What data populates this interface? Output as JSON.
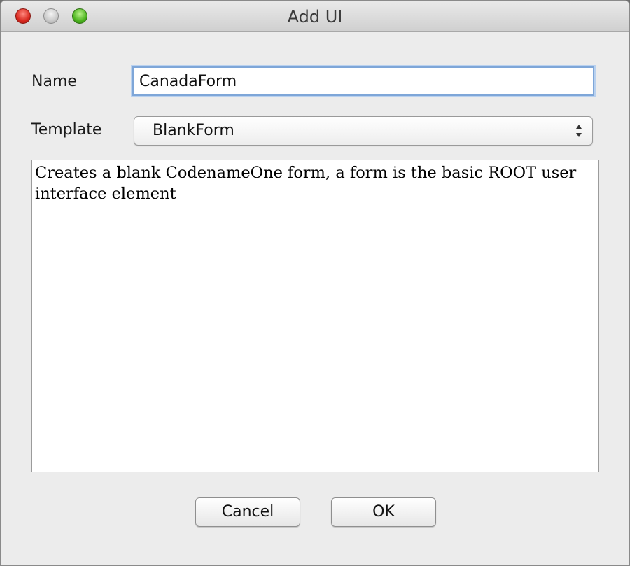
{
  "window": {
    "title": "Add UI"
  },
  "form": {
    "name_label": "Name",
    "name_value": "CanadaForm",
    "template_label": "Template",
    "template_value": "BlankForm",
    "description": "Creates a blank CodenameOne form, a form is the basic ROOT user interface element"
  },
  "buttons": {
    "cancel_label": "Cancel",
    "ok_label": "OK"
  },
  "colors": {
    "close": "#d8281e",
    "minimize": "#c9c9c9",
    "maximize": "#4cb41f",
    "focus_ring": "#7ea6d8"
  },
  "icons": {
    "close": "close-icon",
    "minimize": "minimize-icon",
    "maximize": "maximize-icon",
    "select_arrows": "up-down-arrows-icon"
  }
}
